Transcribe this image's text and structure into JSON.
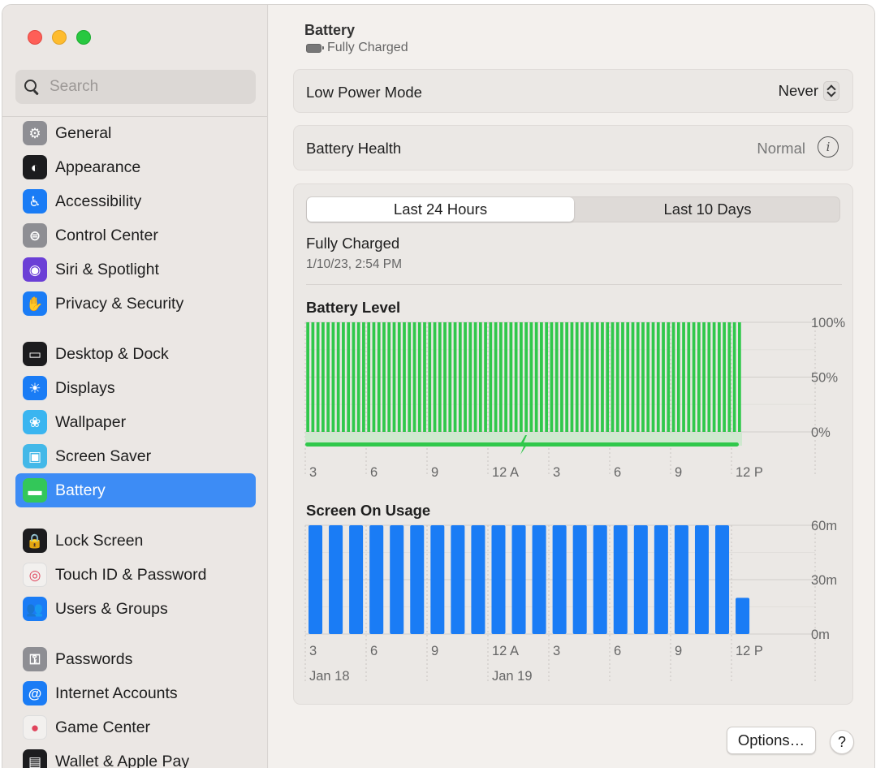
{
  "window": {
    "title": "Battery"
  },
  "sidebar": {
    "search_placeholder": "Search",
    "items": [
      {
        "label": "General",
        "icon": "gear-icon",
        "color": "#8e8e93",
        "glyph": "⚙"
      },
      {
        "label": "Appearance",
        "icon": "appearance-icon",
        "color": "#1c1c1e",
        "glyph": "◐"
      },
      {
        "label": "Accessibility",
        "icon": "accessibility-icon",
        "color": "#1a7cf5",
        "glyph": "♿"
      },
      {
        "label": "Control Center",
        "icon": "control-center-icon",
        "color": "#8e8e93",
        "glyph": "⊜"
      },
      {
        "label": "Siri & Spotlight",
        "icon": "siri-icon",
        "color": "#6b3fd6",
        "glyph": "◉"
      },
      {
        "label": "Privacy & Security",
        "icon": "hand-icon",
        "color": "#1a7cf5",
        "glyph": "✋"
      },
      {
        "label": "Desktop & Dock",
        "icon": "dock-icon",
        "color": "#1c1c1e",
        "glyph": "▭"
      },
      {
        "label": "Displays",
        "icon": "sun-icon",
        "color": "#1a7cf5",
        "glyph": "☀"
      },
      {
        "label": "Wallpaper",
        "icon": "flower-icon",
        "color": "#3ab5f0",
        "glyph": "❀"
      },
      {
        "label": "Screen Saver",
        "icon": "screen-saver-icon",
        "color": "#43b8e8",
        "glyph": "▣"
      },
      {
        "label": "Battery",
        "icon": "battery-icon",
        "color": "#33c759",
        "glyph": "▬",
        "selected": true
      },
      {
        "label": "Lock Screen",
        "icon": "lock-icon",
        "color": "#1c1c1e",
        "glyph": "🔒"
      },
      {
        "label": "Touch ID & Password",
        "icon": "fingerprint-icon",
        "color": "#f2f0ee",
        "glyph": "◎"
      },
      {
        "label": "Users & Groups",
        "icon": "users-icon",
        "color": "#1a7cf5",
        "glyph": "👥"
      },
      {
        "label": "Passwords",
        "icon": "key-icon",
        "color": "#8e8e93",
        "glyph": "⚿"
      },
      {
        "label": "Internet Accounts",
        "icon": "at-icon",
        "color": "#1a7cf5",
        "glyph": "@"
      },
      {
        "label": "Game Center",
        "icon": "game-center-icon",
        "color": "#f2f0ee",
        "glyph": "●"
      },
      {
        "label": "Wallet & Apple Pay",
        "icon": "wallet-icon",
        "color": "#1c1c1e",
        "glyph": "▤"
      }
    ]
  },
  "header": {
    "title": "Battery",
    "subtitle": "Fully Charged"
  },
  "low_power_mode": {
    "label": "Low Power Mode",
    "value": "Never"
  },
  "battery_health": {
    "label": "Battery Health",
    "value": "Normal"
  },
  "tabs": {
    "last_24": "Last 24 Hours",
    "last_10": "Last 10 Days"
  },
  "status": {
    "title": "Fully Charged",
    "timestamp": "1/10/23, 2:54 PM"
  },
  "chart_data": [
    {
      "type": "bar",
      "title": "Battery Level",
      "colors": {
        "bar": "#30c84b",
        "charging_band": "#cfe8cf",
        "charging_line": "#30c84b"
      },
      "y_ticks": [
        "100%",
        "50%",
        "0%"
      ],
      "ylim": [
        0,
        100
      ],
      "x_tick_labels": [
        "3",
        "6",
        "9",
        "12 A",
        "3",
        "6",
        "9",
        "12 P"
      ],
      "values": [
        100,
        100,
        100,
        100,
        100,
        100,
        100,
        100,
        100,
        100,
        100,
        100,
        100,
        100,
        100,
        100,
        100,
        100,
        100,
        100,
        100,
        100,
        100,
        100,
        100,
        100,
        100,
        100,
        100,
        100,
        100,
        100,
        100,
        100,
        100,
        100,
        100,
        100,
        100,
        100,
        100,
        100,
        100,
        100,
        100,
        100,
        100,
        100,
        100,
        100,
        100,
        100,
        100,
        100,
        100,
        100,
        100,
        100,
        100,
        100,
        100,
        100,
        100,
        100,
        100,
        100,
        100,
        100,
        100,
        100,
        100,
        100,
        100,
        100,
        100,
        100,
        100,
        100,
        100,
        100,
        100,
        100,
        100,
        100,
        100,
        100
      ]
    },
    {
      "type": "bar",
      "title": "Screen On Usage",
      "colors": {
        "bar": "#1a7cf5"
      },
      "y_ticks": [
        "60m",
        "30m",
        "0m"
      ],
      "ylim": [
        0,
        60
      ],
      "x_tick_labels": [
        "3",
        "6",
        "9",
        "12 A",
        "3",
        "6",
        "9",
        "12 P"
      ],
      "date_labels": [
        "Jan 18",
        "Jan 19"
      ],
      "values": [
        60,
        60,
        60,
        60,
        60,
        60,
        60,
        60,
        60,
        60,
        60,
        60,
        60,
        60,
        60,
        60,
        60,
        60,
        60,
        60,
        60,
        20
      ]
    }
  ],
  "buttons": {
    "options": "Options…",
    "help": "?"
  }
}
